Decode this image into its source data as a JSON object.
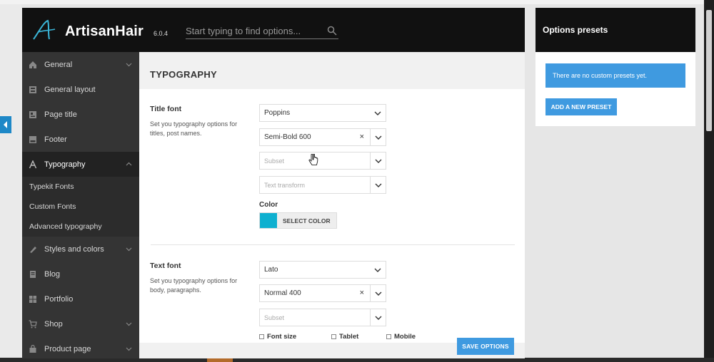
{
  "app": {
    "brand": "ArtisanHair",
    "version": "6.0.4",
    "search_placeholder": "Start typing to find options..."
  },
  "sidebar": {
    "items": [
      {
        "label": "General",
        "icon": "home-icon",
        "has_chevron": true
      },
      {
        "label": "General layout",
        "icon": "layout-icon",
        "has_chevron": false
      },
      {
        "label": "Page title",
        "icon": "page-title-icon",
        "has_chevron": false
      },
      {
        "label": "Footer",
        "icon": "footer-icon",
        "has_chevron": false
      },
      {
        "label": "Typography",
        "icon": "typography-icon",
        "has_chevron": true,
        "active": true
      },
      {
        "label": "Styles and colors",
        "icon": "brush-icon",
        "has_chevron": true
      },
      {
        "label": "Blog",
        "icon": "blog-icon",
        "has_chevron": false
      },
      {
        "label": "Portfolio",
        "icon": "grid-icon",
        "has_chevron": false
      },
      {
        "label": "Shop",
        "icon": "cart-icon",
        "has_chevron": true
      },
      {
        "label": "Product page",
        "icon": "bag-icon",
        "has_chevron": true
      }
    ],
    "subitems": [
      "Typekit Fonts",
      "Custom Fonts",
      "Advanced typography"
    ]
  },
  "content": {
    "title": "TYPOGRAPHY",
    "title_font": {
      "heading": "Title font",
      "description": "Set you typography options for titles, post names.",
      "family": "Poppins",
      "weight": "Semi-Bold 600",
      "subset_placeholder": "Subset",
      "transform_placeholder": "Text transform",
      "color_label": "Color",
      "color_value": "#0eb0d0",
      "select_color_label": "SELECT COLOR"
    },
    "text_font": {
      "heading": "Text font",
      "description": "Set you typography options for body, paragraphs.",
      "family": "Lato",
      "weight": "Normal 400",
      "subset_placeholder": "Subset",
      "font_size_label": "Font size",
      "tablet_label": "Tablet",
      "mobile_label": "Mobile"
    },
    "clear_symbol": "×",
    "save_label": "SAVE OPTIONS"
  },
  "presets": {
    "title": "Options presets",
    "notice": "There are no custom presets yet.",
    "add_label": "ADD A NEW PRESET"
  }
}
